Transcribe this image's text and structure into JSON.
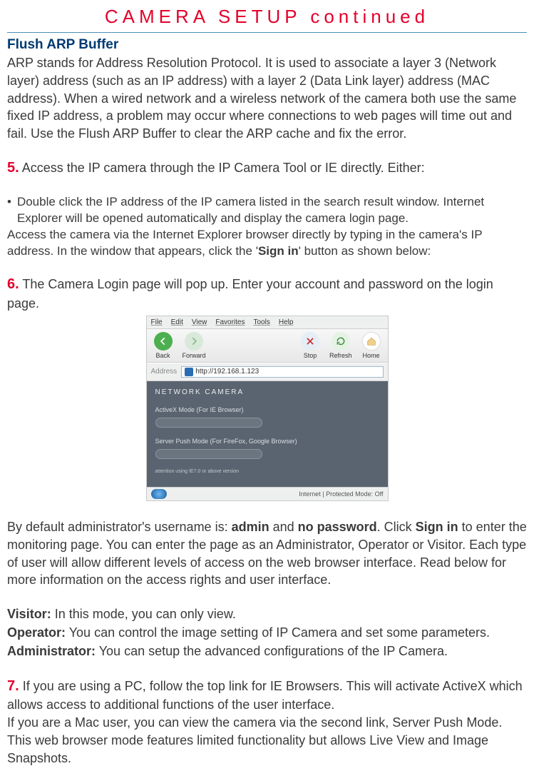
{
  "title": "CAMERA SETUP continued",
  "flush_heading": "Flush ARP Buffer",
  "flush_para": "ARP stands for Address Resolution Protocol. It is used to associate a layer 3 (Network layer) address (such as an IP address) with a layer 2 (Data Link layer) address (MAC address). When a wired network and a wireless network of the camera both use the same fixed IP address, a problem may occur where connections to web pages will time out and fail. Use the Flush ARP Buffer to clear the ARP cache and fix the error.",
  "step5_num": "5.",
  "step5_text": " Access the IP camera through the IP Camera Tool or IE directly. Either:",
  "bullet_text": "Double click the IP address of the IP camera listed in the search result window. Internet Explorer will be opened automatically and display the camera login page.",
  "alt_access_pre": "Access the camera via the Internet Explorer browser directly by typing in the camera's IP address. In the window that appears, click the '",
  "alt_access_bold": "Sign in",
  "alt_access_post": "' button as shown below:",
  "step6_num": "6.",
  "step6_text": " The Camera Login page will pop up. Enter your account and password on the login page.",
  "browser": {
    "menu": {
      "file": "File",
      "edit": "Edit",
      "view": "View",
      "favorites": "Favorites",
      "tools": "Tools",
      "help": "Help"
    },
    "toolbar": {
      "back": "Back",
      "forward": "Forward",
      "stop": "Stop",
      "refresh": "Refresh",
      "home": "Home"
    },
    "addr_label": "Address",
    "addr_value": "http://192.168.1.123",
    "page": {
      "heading": "NETWORK CAMERA",
      "mode1": "ActiveX Mode (For IE Browser)",
      "mode2": "Server Push Mode (For FireFox, Google Browser)",
      "note": "attention using IE7.0 or above version"
    },
    "footer": "Internet | Protected Mode: Off"
  },
  "default_para_pre": "By default administrator's username is: ",
  "default_admin": "admin",
  "default_and": " and ",
  "default_nopass": "no password",
  "default_click": ". Click ",
  "default_signin": "Sign in",
  "default_rest": " to enter the monitoring page. You can enter the page as an Administrator, Operator or Visitor. Each type of user will allow different levels of access on the web browser interface. Read below for more information on the access rights and user interface.",
  "roles": {
    "visitor_label": "Visitor:",
    "visitor_text": " In this mode, you can only view.",
    "operator_label": "Operator:",
    "operator_text": " You can control the image setting of IP Camera and set some parameters.",
    "admin_label": "Administrator:",
    "admin_text": " You can setup the advanced configurations of the IP Camera."
  },
  "step7_num": "7.",
  "step7_text": " If you are using a PC, follow the top link for IE Browsers. This will activate ActiveX which allows access to additional functions of the user interface.",
  "step7_mac": "If you are a Mac user, you can view the camera via the second link, Server Push Mode. This web browser mode features limited functionality but allows Live View and Image Snapshots."
}
